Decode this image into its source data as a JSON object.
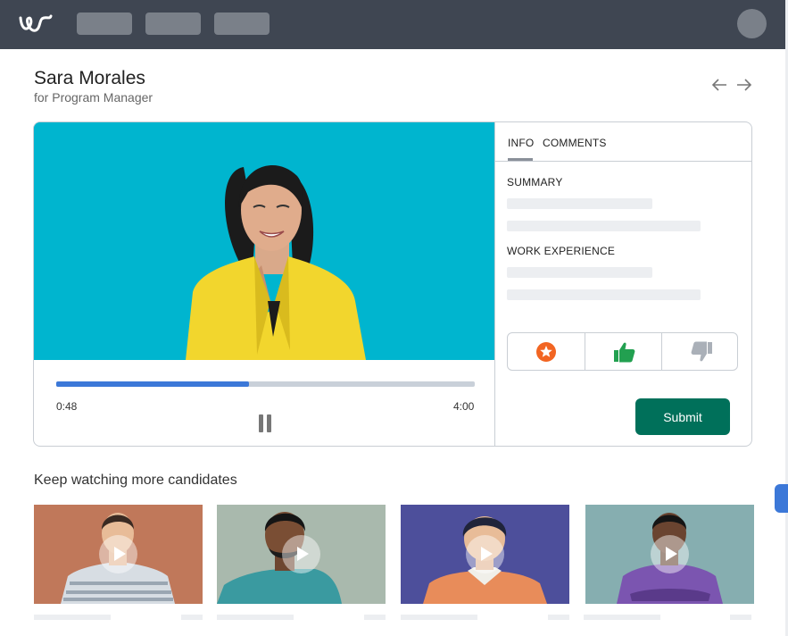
{
  "candidate": {
    "name": "Sara Morales",
    "role": "for Program Manager"
  },
  "video": {
    "current_time": "0:48",
    "total_time": "4:00",
    "progress": 0.46
  },
  "tabs": [
    {
      "label": "INFO",
      "active": true
    },
    {
      "label": "COMMENTS",
      "active": false
    }
  ],
  "info": {
    "summary_title": "SUMMARY",
    "work_title": "WORK EXPERIENCE"
  },
  "submit_label": "Submit",
  "more": {
    "title": "Keep watching more candidates",
    "items": [
      {
        "bg": "#c0785a"
      },
      {
        "bg": "#a9b9ad"
      },
      {
        "bg": "#4d4f9b"
      },
      {
        "bg": "#86aeb0"
      }
    ]
  },
  "colors": {
    "topbar": "#3f4652",
    "accent_blue": "#3c78d8",
    "submit_green": "#00705a",
    "video_bg": "#00b5cf",
    "star_orange": "#f26522",
    "thumb_green": "#22a050"
  },
  "icons": {
    "logo": "logo-icon",
    "prev": "arrow-left-icon",
    "next": "arrow-right-icon",
    "pause": "pause-icon",
    "star": "star-badge-icon",
    "thumb_up": "thumbs-up-icon",
    "thumb_down": "thumbs-down-icon",
    "play": "play-icon"
  }
}
